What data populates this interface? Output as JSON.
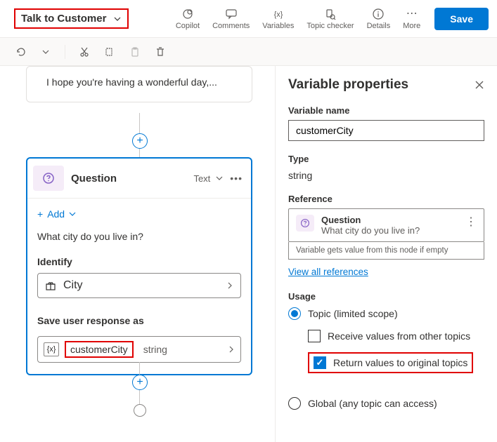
{
  "topic_name": "Talk to Customer",
  "toolbar": {
    "copilot": "Copilot",
    "comments": "Comments",
    "variables": "Variables",
    "topic_checker": "Topic checker",
    "details": "Details",
    "more": "More",
    "save": "Save"
  },
  "message_card": {
    "text": "I hope you're having a wonderful day,..."
  },
  "question_card": {
    "title": "Question",
    "type_label": "Text",
    "add_label": "Add",
    "question_text": "What city do you live in?",
    "identify_label": "Identify",
    "identify_value": "City",
    "save_as_label": "Save user response as",
    "var_name": "customerCity",
    "var_type": "string"
  },
  "panel": {
    "title": "Variable properties",
    "var_name_label": "Variable name",
    "var_name_value": "customerCity",
    "type_label": "Type",
    "type_value": "string",
    "reference_label": "Reference",
    "ref_title": "Question",
    "ref_sub": "What city do you live in?",
    "ref_note": "Variable gets value from this node if empty",
    "view_all": "View all references",
    "usage_label": "Usage",
    "usage_topic": "Topic (limited scope)",
    "usage_receive": "Receive values from other topics",
    "usage_return": "Return values to original topics",
    "usage_global": "Global (any topic can access)"
  }
}
